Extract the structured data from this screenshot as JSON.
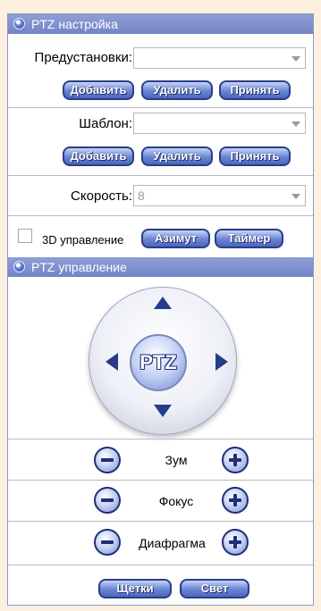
{
  "ptz_setup": {
    "title": "PTZ настройка",
    "presets_label": "Предустановки:",
    "presets_value": "",
    "preset_buttons": [
      "Добавить",
      "Удалить",
      "Принять"
    ],
    "template_label": "Шаблон:",
    "template_value": "",
    "template_buttons": [
      "Добавить",
      "Удалить",
      "Принять"
    ],
    "speed_label": "Скорость:",
    "speed_value": "8",
    "control_3d_label": "3D управление",
    "azimuth_button": "Азимут",
    "timer_button": "Таймер"
  },
  "ptz_control": {
    "title": "PTZ управление",
    "center_label": "PTZ",
    "zoom_label": "Зум",
    "focus_label": "Фокус",
    "iris_label": "Диафрагма",
    "wiper_button": "Щетки",
    "light_button": "Свет"
  },
  "colors": {
    "header": "#7f8fcf",
    "button": "#5a73c6",
    "background": "#fdf0e0"
  }
}
